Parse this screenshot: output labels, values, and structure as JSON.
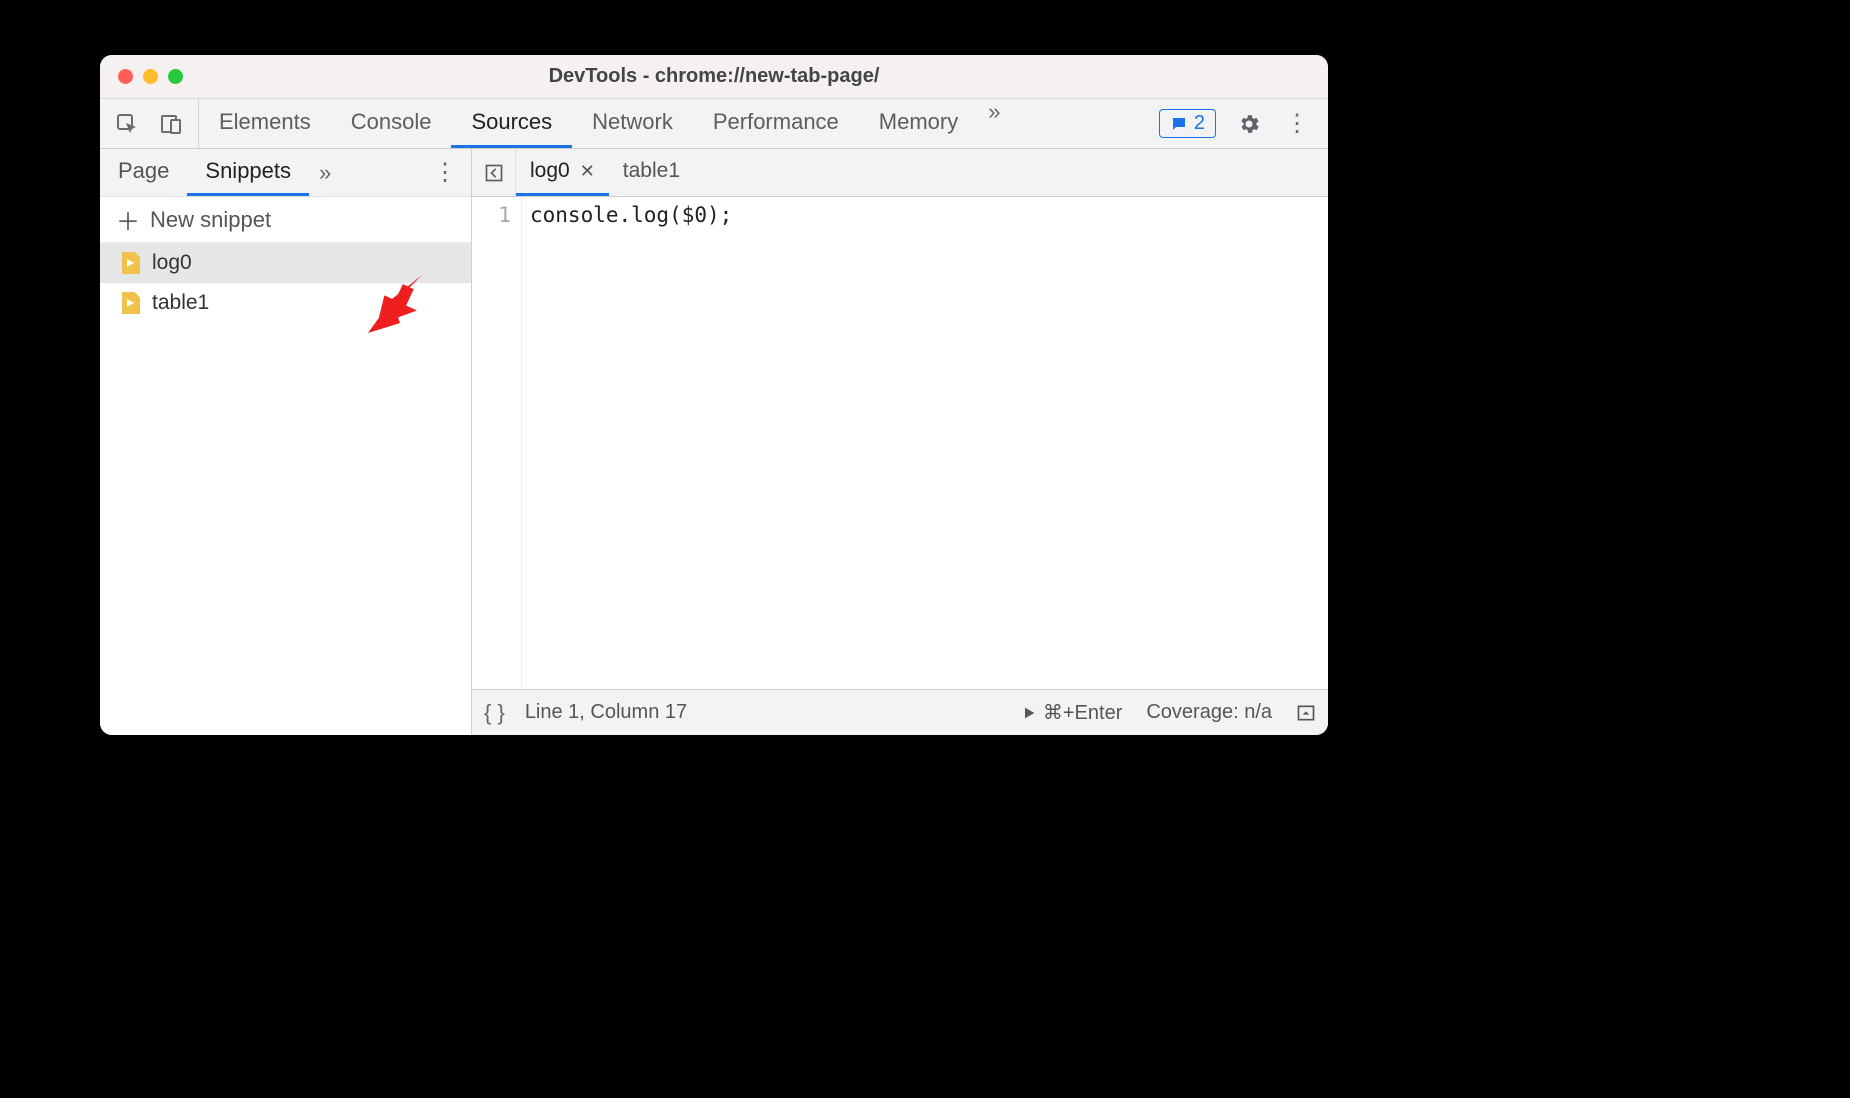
{
  "window": {
    "title": "DevTools - chrome://new-tab-page/"
  },
  "main_tabs": {
    "items": [
      "Elements",
      "Console",
      "Sources",
      "Network",
      "Performance",
      "Memory"
    ],
    "active_index": 2,
    "overflow_glyph": "»",
    "messages_count": "2"
  },
  "sidebar": {
    "tabs": {
      "items": [
        "Page",
        "Snippets"
      ],
      "active_index": 1,
      "overflow_glyph": "»"
    },
    "new_snippet_label": "New snippet",
    "snippets": [
      {
        "name": "log0",
        "selected": true
      },
      {
        "name": "table1",
        "selected": false
      }
    ]
  },
  "editor": {
    "tabs": [
      {
        "name": "log0",
        "active": true,
        "closable": true
      },
      {
        "name": "table1",
        "active": false,
        "closable": false
      }
    ],
    "lines": [
      {
        "num": "1",
        "text": "console.log($0);"
      }
    ]
  },
  "status": {
    "format_glyph": "{ }",
    "cursor": "Line 1, Column 17",
    "run_hint": "⌘+Enter",
    "coverage": "Coverage: n/a"
  }
}
